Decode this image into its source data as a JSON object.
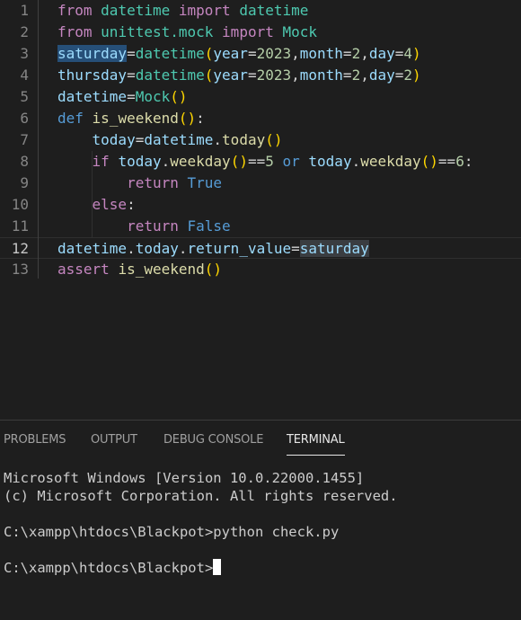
{
  "editor": {
    "line_numbers": [
      "1",
      "2",
      "3",
      "4",
      "5",
      "6",
      "7",
      "8",
      "9",
      "10",
      "11",
      "12",
      "13"
    ],
    "current_line": "12",
    "lines": [
      [
        {
          "t": "from",
          "c": "ctl"
        },
        {
          "t": " "
        },
        {
          "t": "datetime",
          "c": "mod"
        },
        {
          "t": " "
        },
        {
          "t": "import",
          "c": "ctl"
        },
        {
          "t": " "
        },
        {
          "t": "datetime",
          "c": "mod"
        }
      ],
      [
        {
          "t": "from",
          "c": "ctl"
        },
        {
          "t": " "
        },
        {
          "t": "unittest.mock",
          "c": "mod"
        },
        {
          "t": " "
        },
        {
          "t": "import",
          "c": "ctl"
        },
        {
          "t": " "
        },
        {
          "t": "Mock",
          "c": "mod"
        }
      ],
      [
        {
          "t": "saturday",
          "c": "var hl"
        },
        {
          "t": "=",
          "c": "op"
        },
        {
          "t": "datetime",
          "c": "mod"
        },
        {
          "t": "(",
          "c": "par"
        },
        {
          "t": "year",
          "c": "var"
        },
        {
          "t": "="
        },
        {
          "t": "2023",
          "c": "num"
        },
        {
          "t": ","
        },
        {
          "t": "month",
          "c": "var"
        },
        {
          "t": "="
        },
        {
          "t": "2",
          "c": "num"
        },
        {
          "t": ","
        },
        {
          "t": "day",
          "c": "var"
        },
        {
          "t": "="
        },
        {
          "t": "4",
          "c": "num"
        },
        {
          "t": ")",
          "c": "par"
        }
      ],
      [
        {
          "t": "thursday",
          "c": "var"
        },
        {
          "t": "=",
          "c": "op"
        },
        {
          "t": "datetime",
          "c": "mod"
        },
        {
          "t": "(",
          "c": "par"
        },
        {
          "t": "year",
          "c": "var"
        },
        {
          "t": "="
        },
        {
          "t": "2023",
          "c": "num"
        },
        {
          "t": ","
        },
        {
          "t": "month",
          "c": "var"
        },
        {
          "t": "="
        },
        {
          "t": "2",
          "c": "num"
        },
        {
          "t": ","
        },
        {
          "t": "day",
          "c": "var"
        },
        {
          "t": "="
        },
        {
          "t": "2",
          "c": "num"
        },
        {
          "t": ")",
          "c": "par"
        }
      ],
      [
        {
          "t": "datetime",
          "c": "var"
        },
        {
          "t": "=",
          "c": "op"
        },
        {
          "t": "Mock",
          "c": "mod"
        },
        {
          "t": "()",
          "c": "par"
        }
      ],
      [
        {
          "t": "def",
          "c": "kw"
        },
        {
          "t": " "
        },
        {
          "t": "is_weekend",
          "c": "fn"
        },
        {
          "t": "()",
          "c": "par"
        },
        {
          "t": ":"
        }
      ],
      [
        {
          "t": "    "
        },
        {
          "t": "today",
          "c": "var"
        },
        {
          "t": "=",
          "c": "op"
        },
        {
          "t": "datetime",
          "c": "var"
        },
        {
          "t": "."
        },
        {
          "t": "today",
          "c": "fn"
        },
        {
          "t": "()",
          "c": "par"
        }
      ],
      [
        {
          "t": "    "
        },
        {
          "t": "if",
          "c": "ctl"
        },
        {
          "t": " "
        },
        {
          "t": "today",
          "c": "var"
        },
        {
          "t": "."
        },
        {
          "t": "weekday",
          "c": "fn"
        },
        {
          "t": "()",
          "c": "par"
        },
        {
          "t": "=="
        },
        {
          "t": "5",
          "c": "num"
        },
        {
          "t": " "
        },
        {
          "t": "or",
          "c": "kw"
        },
        {
          "t": " "
        },
        {
          "t": "today",
          "c": "var"
        },
        {
          "t": "."
        },
        {
          "t": "weekday",
          "c": "fn"
        },
        {
          "t": "()",
          "c": "par"
        },
        {
          "t": "=="
        },
        {
          "t": "6",
          "c": "num"
        },
        {
          "t": ":"
        }
      ],
      [
        {
          "t": "        "
        },
        {
          "t": "return",
          "c": "ctl"
        },
        {
          "t": " "
        },
        {
          "t": "True",
          "c": "kw"
        }
      ],
      [
        {
          "t": "    "
        },
        {
          "t": "else",
          "c": "ctl"
        },
        {
          "t": ":"
        }
      ],
      [
        {
          "t": "        "
        },
        {
          "t": "return",
          "c": "ctl"
        },
        {
          "t": " "
        },
        {
          "t": "False",
          "c": "kw"
        }
      ],
      [
        {
          "t": "datetime",
          "c": "var"
        },
        {
          "t": "."
        },
        {
          "t": "today",
          "c": "var"
        },
        {
          "t": "."
        },
        {
          "t": "return_value",
          "c": "var"
        },
        {
          "t": "=",
          "c": "op"
        },
        {
          "t": "saturday",
          "c": "var hl2"
        }
      ],
      [
        {
          "t": "assert",
          "c": "ctl"
        },
        {
          "t": " "
        },
        {
          "t": "is_weekend",
          "c": "fn"
        },
        {
          "t": "()",
          "c": "par"
        }
      ]
    ]
  },
  "panel": {
    "tabs": [
      {
        "label": "PROBLEMS",
        "active": false
      },
      {
        "label": "OUTPUT",
        "active": false
      },
      {
        "label": "DEBUG CONSOLE",
        "active": false
      },
      {
        "label": "TERMINAL",
        "active": true
      }
    ],
    "terminal": {
      "lines": [
        "Microsoft Windows [Version 10.0.22000.1455]",
        "(c) Microsoft Corporation. All rights reserved.",
        "",
        "C:\\xampp\\htdocs\\Blackpot>python check.py",
        "",
        "C:\\xampp\\htdocs\\Blackpot>"
      ]
    }
  }
}
